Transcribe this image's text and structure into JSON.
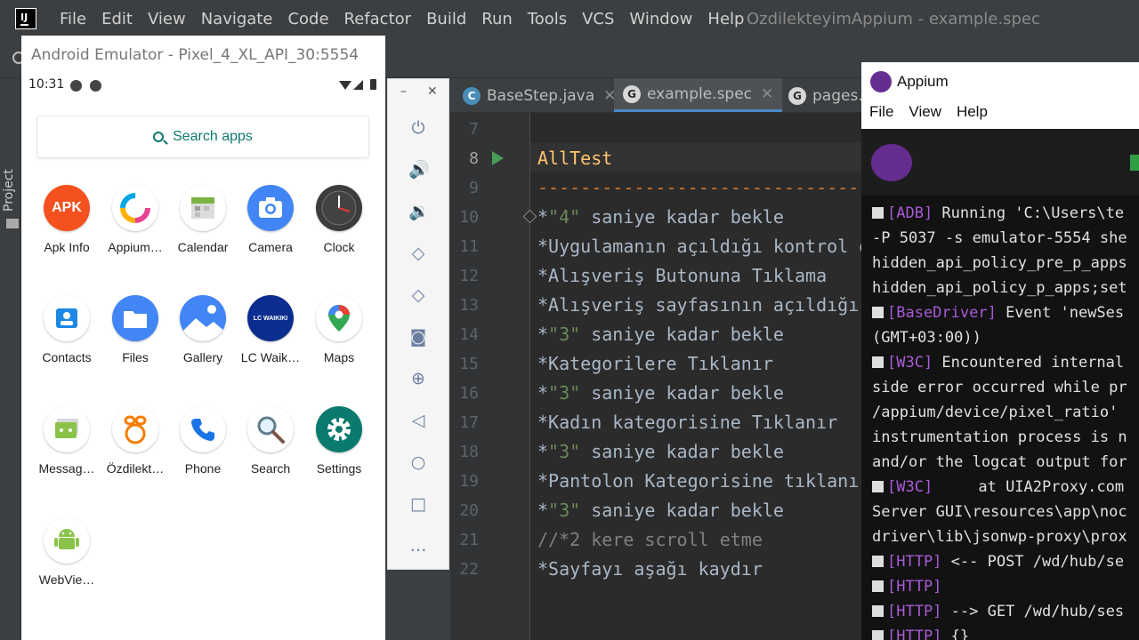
{
  "ide": {
    "menu": [
      "File",
      "Edit",
      "View",
      "Navigate",
      "Code",
      "Refactor",
      "Build",
      "Run",
      "Tools",
      "VCS",
      "Window",
      "Help"
    ],
    "title": "OzdilekteyimAppium - example.spec",
    "project_label": "Project",
    "tabs": [
      {
        "label": "BaseStep.java",
        "icon": "C"
      },
      {
        "label": "example.spec",
        "icon": "G"
      },
      {
        "label": "pages.",
        "icon": "G"
      }
    ],
    "code": [
      {
        "no": "7",
        "text": ""
      },
      {
        "no": "8",
        "text": "AllTest"
      },
      {
        "no": "9",
        "text": "--------------------------------------------------------------"
      },
      {
        "no": "10",
        "pre": "*",
        "str": "\"4\"",
        "post": " saniye kadar bekle"
      },
      {
        "no": "11",
        "text": "*Uygulamanın açıldığı kontrol edilir"
      },
      {
        "no": "12",
        "text": "*Alışveriş Butonuna Tıklama"
      },
      {
        "no": "13",
        "text": "*Alışveriş sayfasının açıldığı kontrol edilir"
      },
      {
        "no": "14",
        "pre": "*",
        "str": "\"3\"",
        "post": " saniye kadar bekle"
      },
      {
        "no": "15",
        "text": "*Kategorilere Tıklanır"
      },
      {
        "no": "16",
        "pre": "*",
        "str": "\"3\"",
        "post": " saniye kadar bekle"
      },
      {
        "no": "17",
        "text": "*Kadın kategorisine Tıklanır"
      },
      {
        "no": "18",
        "pre": "*",
        "str": "\"3\"",
        "post": " saniye kadar bekle"
      },
      {
        "no": "19",
        "text": "*Pantolon Kategorisine tıklanır"
      },
      {
        "no": "20",
        "pre": "*",
        "str": "\"3\"",
        "post": " saniye kadar bekle"
      },
      {
        "no": "21",
        "text": "//*2 kere scroll etme"
      },
      {
        "no": "22",
        "text": "*Sayfayı aşağı kaydır"
      }
    ]
  },
  "emulator": {
    "title": "Android Emulator - Pixel_4_XL_API_30:5554",
    "time": "10:31",
    "search_placeholder": "Search apps",
    "apps": [
      {
        "label": "Apk Info",
        "icon": "APK",
        "color": "#f4511e"
      },
      {
        "label": "Appium…",
        "icon": "",
        "color": "#ffffff"
      },
      {
        "label": "Calendar",
        "icon": "",
        "color": "#ffffff"
      },
      {
        "label": "Camera",
        "icon": "",
        "color": "#4285f4"
      },
      {
        "label": "Clock",
        "icon": "",
        "color": "#3c3c3c"
      },
      {
        "label": "Contacts",
        "icon": "",
        "color": "#ffffff"
      },
      {
        "label": "Files",
        "icon": "",
        "color": "#4285f4"
      },
      {
        "label": "Gallery",
        "icon": "",
        "color": "#4285f4"
      },
      {
        "label": "LC Waik…",
        "icon": "LC WAIKIKI",
        "color": "#0b2d8f"
      },
      {
        "label": "Maps",
        "icon": "",
        "color": "#ffffff"
      },
      {
        "label": "Messag…",
        "icon": "",
        "color": "#ffffff"
      },
      {
        "label": "Özdilekt…",
        "icon": "",
        "color": "#ffffff"
      },
      {
        "label": "Phone",
        "icon": "",
        "color": "#ffffff"
      },
      {
        "label": "Search",
        "icon": "",
        "color": "#ffffff"
      },
      {
        "label": "Settings",
        "icon": "",
        "color": "#0b7a6e"
      },
      {
        "label": "WebVie…",
        "icon": "",
        "color": "#ffffff"
      }
    ]
  },
  "appium": {
    "title": "Appium",
    "menu": [
      "File",
      "View",
      "Help"
    ],
    "log": [
      {
        "tag": "[ADB]",
        "text": " Running 'C:\\Users\\te"
      },
      {
        "tag": "",
        "text": "-P 5037 -s emulator-5554 she"
      },
      {
        "tag": "",
        "text": "hidden_api_policy_pre_p_apps"
      },
      {
        "tag": "",
        "text": "hidden_api_policy_p_apps;set"
      },
      {
        "tag": "[BaseDriver]",
        "text": " Event 'newSes"
      },
      {
        "tag": "",
        "text": "(GMT+03:00))"
      },
      {
        "tag": "[W3C]",
        "text": " Encountered internal"
      },
      {
        "tag": "",
        "text": "side error occurred while pr"
      },
      {
        "tag": "",
        "text": "/appium/device/pixel_ratio'"
      },
      {
        "tag": "",
        "text": "instrumentation process is n"
      },
      {
        "tag": "",
        "text": "and/or the logcat output for"
      },
      {
        "tag": "[W3C]",
        "text": "     at UIA2Proxy.com"
      },
      {
        "tag": "",
        "text": "Server GUI\\resources\\app\\noc"
      },
      {
        "tag": "",
        "text": "driver\\lib\\jsonwp-proxy\\prox"
      },
      {
        "tag": "[HTTP]",
        "text": " <-- POST /wd/hub/se"
      },
      {
        "tag": "[HTTP]",
        "text": ""
      },
      {
        "tag": "[HTTP]",
        "text": " --> GET /wd/hub/ses"
      },
      {
        "tag": "[HTTP]",
        "text": " {}"
      }
    ]
  }
}
